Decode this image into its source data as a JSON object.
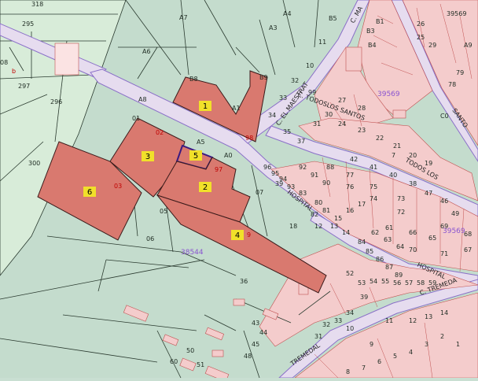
{
  "map": {
    "colors": {
      "green_parcel": "#c4dccd",
      "light_parcel": "#d8ecd9",
      "urban_block": "#f4cccc",
      "highlight_parcel": "#d9796f",
      "street": "#e6dcef",
      "boundary": "#2a3a2f",
      "street_edge": "#8a6fc8",
      "label_yellow": "#f1e02a"
    },
    "streets": {
      "maestrat_top": "C. MA",
      "el_maestrat": "C. EL MAESTRAT",
      "todos_los_santos": "C. TODOSLOS SANTOS",
      "todos_los": "TODOS LOS",
      "santo": "SANTO",
      "hospital_upper": "HOSPITAL",
      "hospital_lower": "HOSPITAL",
      "tremedal_right": "C. TREMEDA",
      "tremedal_left": "TREMEDAL"
    },
    "zone_codes": {
      "north": "39569",
      "east": "39569",
      "center": "38544"
    },
    "highlighted": {
      "p1": "1",
      "p2": "2",
      "p3": "3",
      "p4": "4",
      "p5": "5",
      "p6": "6"
    },
    "red_numbers": {
      "r02": "02",
      "r03": "03",
      "r97": "97",
      "r98": "98",
      "r9": "9",
      "r_b": "b"
    },
    "parcel_numbers": {
      "n318": "318",
      "n295": "295",
      "n297": "297",
      "n296": "296",
      "n300": "300",
      "n08": "08",
      "nA7": "A7",
      "nA4": "A4",
      "nB5": "B5",
      "nA3": "A3",
      "nA6": "A6",
      "nB8": "B8",
      "nB9": "B9",
      "nA8": "A8",
      "nA1": "A1",
      "n01": "01",
      "nA5": "A5",
      "nA0": "A0",
      "n05": "05",
      "n06": "06",
      "n07": "07",
      "n36": "36",
      "n11": "11",
      "n10": "10",
      "n32": "32",
      "n33": "33",
      "n34": "34",
      "n35": "35",
      "n37": "37",
      "n43": "43",
      "n44": "44",
      "n45": "45",
      "n48": "48",
      "n50": "50",
      "n51": "51",
      "n60": "60",
      "n49": "49",
      "n69": "69",
      "n29": "29",
      "n26": "26",
      "n25": "25",
      "n9a": "9",
      "nB1": "B1",
      "nB3": "B3",
      "nB4": "B4",
      "n39569b": "39569",
      "n88": "88",
      "n83": "83",
      "n42": "42",
      "n41": "41",
      "n40": "40",
      "n38": "38",
      "n99": "99",
      "n24": "24",
      "n23": "23",
      "n22": "22",
      "n21": "21",
      "n13": "13",
      "n14": "14",
      "n70": "70",
      "n71": "71",
      "n27": "27",
      "n28": "28",
      "n30": "30",
      "n31": "31",
      "n62": "62",
      "n63": "63",
      "n64": "64",
      "n20": "20",
      "n19": "19",
      "n18": "18",
      "n15": "15",
      "n12": "12",
      "n16": "16",
      "n17": "17",
      "n61": "61",
      "n4": "4",
      "n3": "3",
      "n2": "2",
      "n1": "1",
      "n5": "5",
      "n6": "6",
      "n7": "7",
      "n8": "8",
      "n47": "47",
      "n46": "46",
      "n39": "39",
      "n52": "52",
      "n53": "53",
      "n54": "54",
      "n55": "55",
      "n56": "56",
      "n57": "57",
      "n58": "58",
      "n59": "59",
      "n80": "80",
      "n81": "81",
      "n82": "82",
      "n84": "84",
      "n85": "85",
      "n86": "86",
      "n87": "87",
      "n89": "89",
      "n90": "90",
      "n91": "91",
      "n92": "92",
      "n93": "93",
      "n94": "94",
      "n95": "95",
      "n96": "96",
      "n65": "65",
      "n66": "66",
      "n67": "67",
      "n68": "68",
      "n72": "72",
      "n73": "73",
      "n74": "74",
      "n75": "75",
      "n76": "76",
      "n77": "77",
      "n78": "78",
      "n79": "79",
      "nC0": "C0",
      "nA9": "A9",
      "n7b": "7",
      "n39b": "39",
      "n10b": "10",
      "n11b": "11",
      "n12b": "12",
      "n13b": "13",
      "n14b": "14",
      "n31b": "31",
      "n32b": "32",
      "n33b": "33",
      "n34b": "34"
    }
  }
}
